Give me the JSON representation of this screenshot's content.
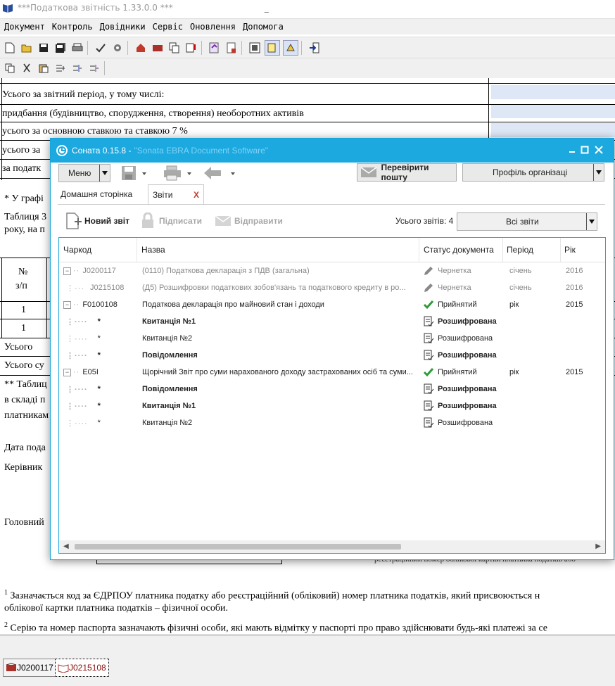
{
  "main": {
    "title": "***Податкова звітність 1.33.0.0 ***",
    "title_dash": "_",
    "menu": [
      "Документ",
      "Контроль",
      "Довідники",
      "Сервіс",
      "Оновлення",
      "Допомога"
    ],
    "doc_rows": [
      "Усього за звітний період, у тому числі:",
      "придбання (будівництво, спорудження, створення) необоротних активів",
      "усього за основною ставкою та ставкою 7 %",
      "усього за",
      "за податк"
    ],
    "doc_texts": {
      "ugrafi": "* У графі",
      "tablytsia": "Таблиця 3",
      "roku": "року, на п",
      "num_header_1": "№",
      "num_header_2": "з/п",
      "one_a": "1",
      "one_b": "1",
      "usogo": "Усього",
      "usogo_su": "Усього су",
      "tabl2": "** Таблиц",
      "v_skladi": "в складі п",
      "platnykam": "платникам",
      "data_poda": "Дата пода",
      "kerivnyk": "Керівник",
      "golovnyi": "Головний",
      "reg_right": "реєстраційний номер облікової картки платника податків або"
    },
    "footnote1_line1": "Зазначається код за ЄДРПОУ платника податку або реєстраційний (обліковий) номер платника податків, який присвоюється н",
    "footnote1_line2": "облікової картки платника податків – фізичної особи.",
    "footnote2": "Серію та номер паспорта зазначають фізичні особи, які мають відмітку у паспорті про право здійснювати будь-які платежі за се",
    "footnote_marks": [
      "1",
      "2"
    ],
    "bottom_tabs": [
      "J0200117",
      "J0215108"
    ]
  },
  "dialog": {
    "title": "Соната 0.15.8 -",
    "title_blur": "\"Sonata EBRA Document Software\"",
    "menu_button": "Меню",
    "check_mail": "Перевірити пошту",
    "org_profile": "Профіль організаці",
    "tabs": {
      "home": "Домашня сторінка",
      "reports": "Звіти",
      "close": "X"
    },
    "actions": {
      "new": "Новий звіт",
      "sign": "Підписати",
      "send": "Відправити"
    },
    "total_label": "Усього звітів: 4",
    "filter": "Всі звіти",
    "columns": [
      "Чаркод",
      "Назва",
      "Статус документа",
      "Період",
      "Рік"
    ],
    "rows": [
      {
        "code": "J0200117",
        "name": "(0110) Податкова декларація з ПДВ (загальна)",
        "status": "Чернетка",
        "period": "січень",
        "year": "2016"
      },
      {
        "code": "J0215108",
        "name": "(Д5) Розшифровки податкових зобов'язань та податкового кредиту в ро...",
        "status": "Чернетка",
        "period": "січень",
        "year": "2016"
      },
      {
        "code": "F0100108",
        "name": "Податкова декларація про майновий стан і доходи",
        "status": "Прийнятий",
        "period": "рік",
        "year": "2015"
      },
      {
        "code": "*",
        "name": "Квитанція №1",
        "status": "Розшифрована",
        "period": "",
        "year": ""
      },
      {
        "code": "*",
        "name": "Квитанція №2",
        "status": "Розшифрована",
        "period": "",
        "year": ""
      },
      {
        "code": "*",
        "name": "Повідомлення",
        "status": "Розшифрована",
        "period": "",
        "year": ""
      },
      {
        "code": "E05I",
        "name": "Щорічний Звіт про суми нарахованого доходу застрахованих осіб та суми...",
        "status": "Прийнятий",
        "period": "рік",
        "year": "2015"
      },
      {
        "code": "*",
        "name": "Повідомлення",
        "status": "Розшифрована",
        "period": "",
        "year": ""
      },
      {
        "code": "*",
        "name": "Квитанція №1",
        "status": "Розшифрована",
        "period": "",
        "year": ""
      },
      {
        "code": "*",
        "name": "Квитанція №2",
        "status": "Розшифрована",
        "period": "",
        "year": ""
      }
    ]
  }
}
